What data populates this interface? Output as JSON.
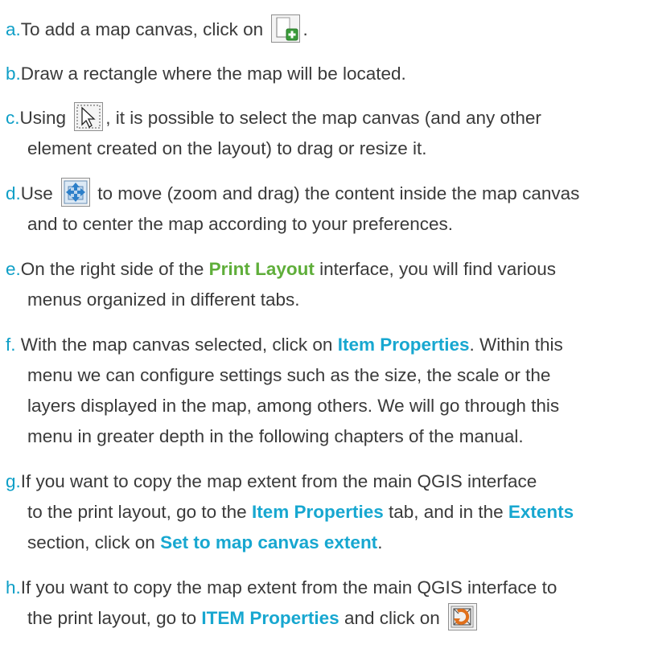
{
  "items": [
    {
      "marker": "a.",
      "t1": "To add a map canvas, click on ",
      "t2": ".",
      "icon": "add-map-icon"
    },
    {
      "marker": "b.",
      "t1": "Draw a rectangle where the map will be located."
    },
    {
      "marker": "c.",
      "t1": "Using ",
      "t2": ", it is possible to select the map canvas (and any other",
      "cont": "element created on the layout) to drag or resize it.",
      "icon": "select-move-item-icon"
    },
    {
      "marker": "d.",
      "t1": "Use ",
      "t2": " to move (zoom and drag) the content inside the map canvas",
      "cont": "and to center the map according to your preferences.",
      "icon": "move-item-content-icon"
    },
    {
      "marker": "e.",
      "t1": "On the right side of the ",
      "h1": "Print Layout",
      "t2": " interface, you will find various",
      "cont": "menus organized in different tabs."
    },
    {
      "marker": "f.",
      "t1": " With the map canvas selected, click on ",
      "h1": "Item Properties",
      "t2": ". Within this",
      "cont1": "menu we can configure settings such as the size, the scale or the",
      "cont2": "layers displayed in the map, among others. We will go through this",
      "cont3": "menu in greater depth in the following chapters of the manual."
    },
    {
      "marker": "g.",
      "t1": "If you want to copy the map extent from the main QGIS interface",
      "c1a": "to the print layout, go to the ",
      "c1h1": "Item Properties",
      "c1b": " tab, and in the ",
      "c1h2": "Extents",
      "c2a": "section, click on ",
      "c2h": "Set to map canvas extent",
      "c2b": "."
    },
    {
      "marker": "h.",
      "t1": "If you want to copy the map extent from the main QGIS interface to",
      "c1a": "the print layout, go to ",
      "c1h": "ITEM Properties",
      "c1b": " and click on ",
      "icon": "set-to-map-canvas-extent-icon"
    }
  ],
  "colors": {
    "marker": "#0f9fc7",
    "highlight": "#17a7d0",
    "highlight_green": "#5fae3a",
    "text": "#3a3a3a"
  }
}
